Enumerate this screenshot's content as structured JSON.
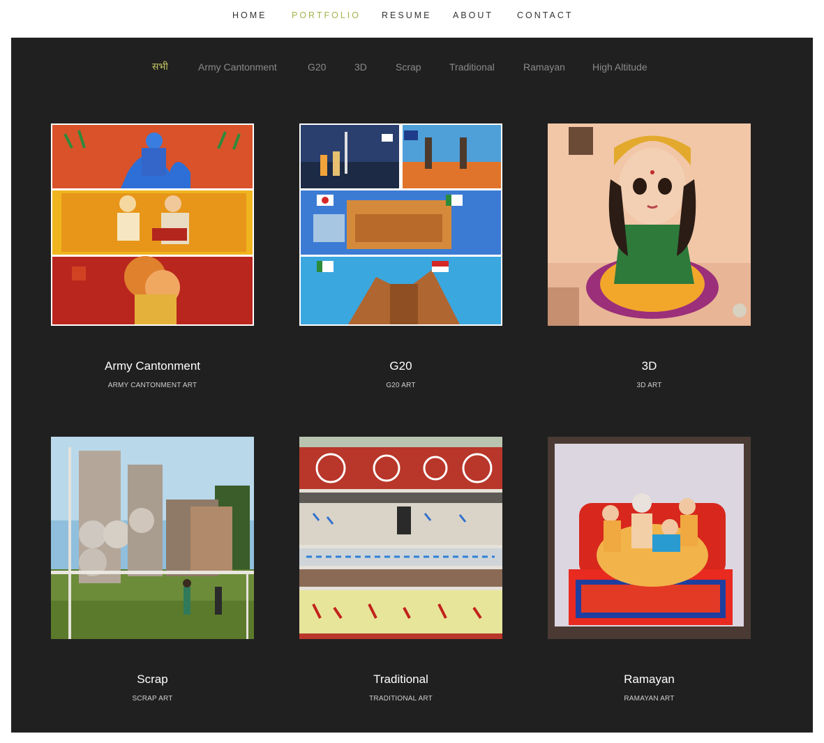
{
  "nav": {
    "items": [
      {
        "label": "HOME"
      },
      {
        "label": "PORTFOLIO"
      },
      {
        "label": "RESUME"
      },
      {
        "label": "ABOUT"
      },
      {
        "label": "CONTACT"
      }
    ],
    "active_color": "#a5b14a"
  },
  "filters": {
    "items": [
      {
        "label": "सभी"
      },
      {
        "label": "Army Cantonment"
      },
      {
        "label": "G20"
      },
      {
        "label": "3D"
      },
      {
        "label": "Scrap"
      },
      {
        "label": "Traditional"
      },
      {
        "label": "Ramayan"
      },
      {
        "label": "High Altitude"
      }
    ],
    "active_color": "#c0c060"
  },
  "portfolio": {
    "items": [
      {
        "title": "Army Cantonment",
        "subtitle": "ARMY CANTONMENT ART"
      },
      {
        "title": "G20",
        "subtitle": "G20 ART"
      },
      {
        "title": "3D",
        "subtitle": "3D ART"
      },
      {
        "title": "Scrap",
        "subtitle": "SCRAP ART"
      },
      {
        "title": "Traditional",
        "subtitle": "TRADITIONAL ART"
      },
      {
        "title": "Ramayan",
        "subtitle": "RAMAYAN ART"
      }
    ]
  },
  "colors": {
    "panel_bg": "#202020",
    "page_bg": "#ffffff"
  }
}
